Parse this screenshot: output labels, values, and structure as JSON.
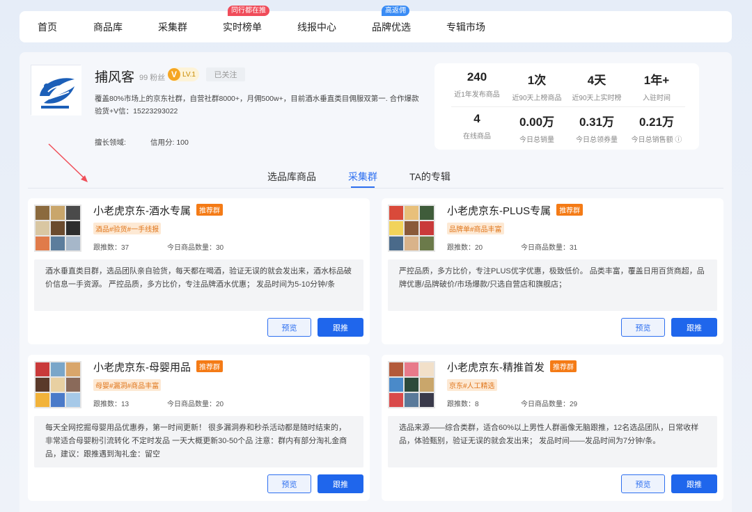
{
  "nav": {
    "items": [
      {
        "label": "首页",
        "badge": "",
        "badge_color": ""
      },
      {
        "label": "商品库",
        "badge": "",
        "badge_color": ""
      },
      {
        "label": "采集群",
        "badge": "",
        "badge_color": ""
      },
      {
        "label": "实时榜单",
        "badge": "同行都在推",
        "badge_color": "#f04c5a"
      },
      {
        "label": "线报中心",
        "badge": "",
        "badge_color": ""
      },
      {
        "label": "品牌优选",
        "badge": "高返佣",
        "badge_color": "#3a8cf5"
      },
      {
        "label": "专辑市场",
        "badge": "",
        "badge_color": ""
      }
    ]
  },
  "profile": {
    "name": "捕风客",
    "fans": "99 粉丝",
    "level": "LV.1",
    "level_icon": "V",
    "follow_status": "已关注",
    "desc": "覆盖80%市场上的京东社群，自营社群8000+，月佣500w+，目前酒水垂直类目佣服双第一. 合作爆款验货+V信：15223293022",
    "skills_label": "擅长领域:",
    "credit": "信用分:  100"
  },
  "stats": [
    {
      "value": "240",
      "label": "近1年发布商品"
    },
    {
      "value": "1次",
      "label": "近90天上榜商品"
    },
    {
      "value": "4天",
      "label": "近90天上实时榜"
    },
    {
      "value": "1年+",
      "label": "入驻时间"
    },
    {
      "value": "4",
      "label": "在线商品"
    },
    {
      "value": "0.00万",
      "label": "今日总销量"
    },
    {
      "value": "0.31万",
      "label": "今日总领券量"
    },
    {
      "value": "0.21万",
      "label": "今日总销售额 ⓘ"
    }
  ],
  "tabs": [
    "选品库商品",
    "采集群",
    "TA的专辑"
  ],
  "active_tab": "采集群",
  "colors": {
    "accent": "#2d6ff0",
    "recommend_tag": "#f47b16",
    "tag_text": "#e0761c"
  },
  "cards": [
    {
      "title": "小老虎京东-酒水专属",
      "rec": "推荐群",
      "tags": "酒品#验货#一手线报",
      "follow": "跟推数：37",
      "today": "今日商品数量：30",
      "desc": "酒水垂直类目群，选品团队亲自验货，每天都在喝酒，验证无误的就会发出来，酒水标品破价信息一手资源。 严控品质，多方比价，专注品牌酒水优惠； 发品时间为5-10分钟/条",
      "preview": "预览",
      "follow_btn": "跟推"
    },
    {
      "title": "小老虎京东-PLUS专属",
      "rec": "推荐群",
      "tags": "品牌单#商品丰富",
      "follow": "跟推数：20",
      "today": "今日商品数量：31",
      "desc": "严控品质，多方比价，专注PLUS优字优惠，极致低价。 品类丰富，覆盖日用百货商超，品牌优惠/品牌破价/市场爆款/只选自营店和旗舰店；",
      "preview": "预览",
      "follow_btn": "跟推"
    },
    {
      "title": "小老虎京东-母婴用品",
      "rec": "推荐群",
      "tags": "母婴#漏洞#商品丰富",
      "follow": "跟推数：13",
      "today": "今日商品数量：20",
      "desc": "每天全网挖掘母婴用品优惠券，第一时间更新！ 很多漏洞券和秒杀活动都是随时结束的，非常适合母婴粉引流转化 不定时发品 一天大概更新30-50个品 注意：群内有部分淘礼金商品，建议：跟推遇到淘礼金：留空",
      "preview": "预览",
      "follow_btn": "跟推"
    },
    {
      "title": "小老虎京东-精推首发",
      "rec": "推荐群",
      "tags": "京东#人工精选",
      "follow": "跟推数：8",
      "today": "今日商品数量：29",
      "desc": "选品来源——综合类群，适合60%以上男性人群画像无脑跟推，12名选品团队，日常收样品，体验甄别，验证无误的就会发出来； 发品时间——发品时间为7分钟/条。",
      "preview": "预览",
      "follow_btn": "跟推"
    }
  ]
}
